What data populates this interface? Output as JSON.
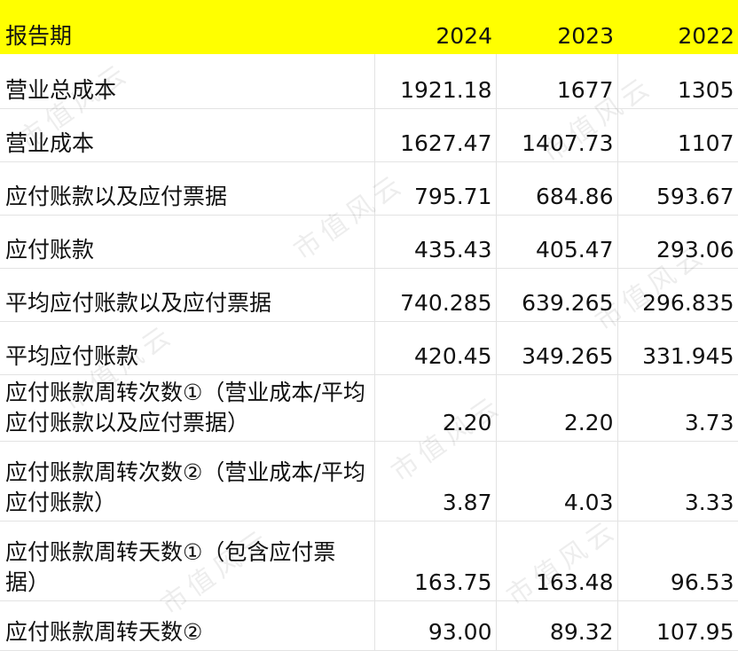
{
  "header": {
    "label": "报告期",
    "years": [
      "2024",
      "2023",
      "2022"
    ]
  },
  "rows": [
    {
      "label": "营业总成本",
      "values": [
        "1921.18",
        "1677",
        "1305"
      ]
    },
    {
      "label": "营业成本",
      "values": [
        "1627.47",
        "1407.73",
        "1107"
      ]
    },
    {
      "label": "应付账款以及应付票据",
      "values": [
        "795.71",
        "684.86",
        "593.67"
      ]
    },
    {
      "label": "应付账款",
      "values": [
        "435.43",
        "405.47",
        "293.06"
      ]
    },
    {
      "label": "平均应付账款以及应付票据",
      "values": [
        "740.285",
        "639.265",
        "296.835"
      ]
    },
    {
      "label": "平均应付账款",
      "values": [
        "420.45",
        "349.265",
        "331.945"
      ]
    },
    {
      "label": "应付账款周转次数①（营业成本/平均应付账款以及应付票据）",
      "values": [
        "2.20",
        "2.20",
        "3.73"
      ]
    },
    {
      "label": "应付账款周转次数②（营业成本/平均应付账款）",
      "values": [
        "3.87",
        "4.03",
        "3.33"
      ]
    },
    {
      "label": "应付账款周转天数①（包含应付票据）",
      "values": [
        "163.75",
        "163.48",
        "96.53"
      ]
    },
    {
      "label": "应付账款周转天数②",
      "values": [
        "93.00",
        "89.32",
        "107.95"
      ]
    }
  ],
  "watermark": "市值风云",
  "colors": {
    "header_bg": "#ffff00",
    "grid": "#e3e3e3"
  }
}
